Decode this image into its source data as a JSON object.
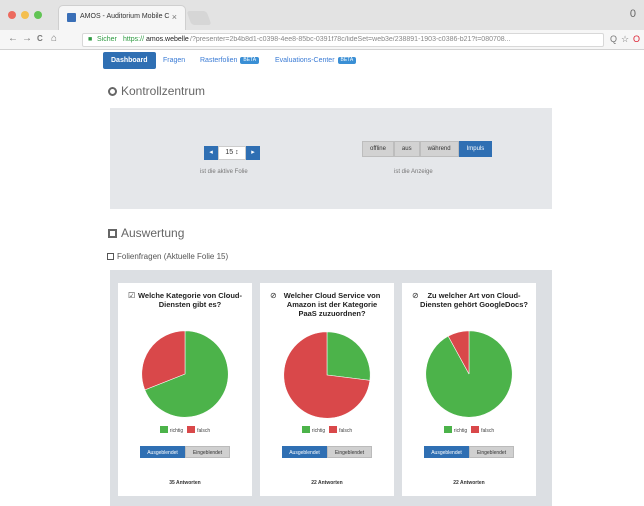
{
  "browser": {
    "tab_title": "AMOS - Auditorium Mobile C",
    "tab_close": "×",
    "address": {
      "secure_label": "Sicher",
      "protocol": "https://",
      "host": "amos.webelle",
      "path": "/?presenter=2b4b8d1-c0398-4ee8-85bc-0391f78c/lideSet=web3e/238891-1903-c0386-b21?t=080708...",
      "corner": "0"
    },
    "nav": {
      "back": "←",
      "forward": "→",
      "reload": "C",
      "home": "⌂"
    },
    "icons": {
      "search": "Q",
      "star": "☆",
      "ext": "O"
    },
    "colors": {
      "secure": "#2d9a40"
    }
  },
  "nav_tabs": [
    {
      "label": "Dashboard",
      "active": true
    },
    {
      "label": "Fragen",
      "active": false
    },
    {
      "label": "Rasterfolien",
      "badge": "BETA",
      "active": false
    },
    {
      "label": "Evaluations-Center",
      "badge": "BETA",
      "active": false
    }
  ],
  "kontrollzentrum": {
    "title": "Kontrollzentrum",
    "stepper": {
      "minus": "◂",
      "value": "15 ↕",
      "plus": "▸",
      "caption": "ist die aktive Folie"
    },
    "segment": {
      "options": [
        "offline",
        "aus",
        "während",
        "Impuls"
      ],
      "active_index": 3,
      "caption": "ist die Anzeige"
    }
  },
  "auswertung": {
    "title": "Auswertung",
    "subtitle": "Folienfragen (Aktuelle Folie 15)"
  },
  "cards": [
    {
      "icon": "☑",
      "question": "Welche Kategorie von Cloud-Diensten gibt es?",
      "correct_pct": 69,
      "legend": [
        "richtig",
        "falsch"
      ],
      "toggle": [
        "Ausgeblendet",
        "Eingeblendet"
      ],
      "toggle_active": 0,
      "answers": "35 Antworten"
    },
    {
      "icon": "⊘",
      "question": "Welcher Cloud Service von Amazon ist der Kategorie PaaS zuzuordnen?",
      "correct_pct": 27,
      "legend": [
        "richtig",
        "falsch"
      ],
      "toggle": [
        "Ausgeblendet",
        "Eingeblendet"
      ],
      "toggle_active": 0,
      "answers": "22 Antworten"
    },
    {
      "icon": "⊘",
      "question": "Zu welcher Art von Cloud-Diensten gehört GoogleDocs?",
      "correct_pct": 92,
      "legend": [
        "richtig",
        "falsch"
      ],
      "toggle": [
        "Ausgeblendet",
        "Eingeblendet"
      ],
      "toggle_active": 0,
      "answers": "22 Antworten"
    }
  ],
  "colors": {
    "primary": "#2f6fb3",
    "correct": "#4cb34a",
    "wrong": "#d9484a",
    "panel": "#e5e7ea"
  }
}
